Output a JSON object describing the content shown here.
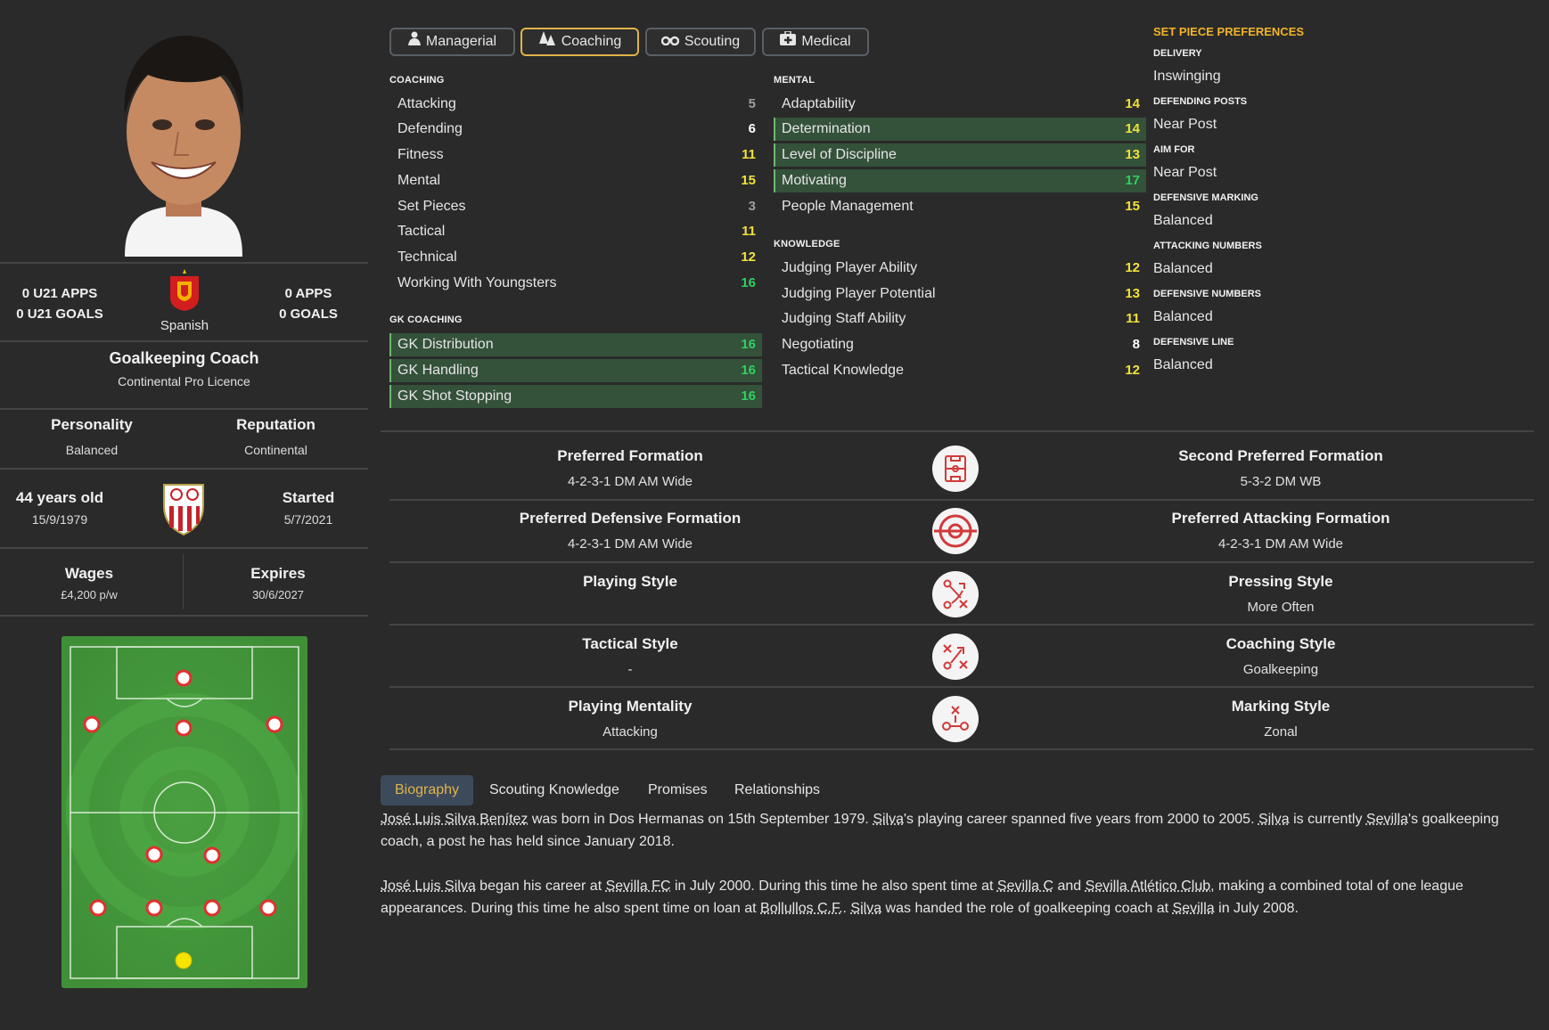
{
  "profile": {
    "u21_apps": "0 U21 APPS",
    "u21_goals": "0 U21 GOALS",
    "apps": "0 APPS",
    "goals": "0 GOALS",
    "nationality": "Spanish",
    "role": "Goalkeeping Coach",
    "licence": "Continental Pro Licence",
    "personality_label": "Personality",
    "personality": "Balanced",
    "reputation_label": "Reputation",
    "reputation": "Continental",
    "age": "44 years old",
    "dob": "15/9/1979",
    "started_label": "Started",
    "started": "5/7/2021",
    "wages_label": "Wages",
    "wages": "£4,200 p/w",
    "expires_label": "Expires",
    "expires": "30/6/2027"
  },
  "tabs": [
    "Managerial",
    "Coaching",
    "Scouting",
    "Medical"
  ],
  "active_tab": "Coaching",
  "coaching": {
    "heading": "COACHING",
    "rows": [
      {
        "label": "Attacking",
        "value": "5"
      },
      {
        "label": "Defending",
        "value": "6"
      },
      {
        "label": "Fitness",
        "value": "11"
      },
      {
        "label": "Mental",
        "value": "15"
      },
      {
        "label": "Set Pieces",
        "value": "3"
      },
      {
        "label": "Tactical",
        "value": "11"
      },
      {
        "label": "Technical",
        "value": "12"
      },
      {
        "label": "Working With Youngsters",
        "value": "16"
      }
    ]
  },
  "gk_coaching": {
    "heading": "GK COACHING",
    "rows": [
      {
        "label": "GK Distribution",
        "value": "16"
      },
      {
        "label": "GK Handling",
        "value": "16"
      },
      {
        "label": "GK Shot Stopping",
        "value": "16"
      }
    ]
  },
  "mental": {
    "heading": "MENTAL",
    "rows": [
      {
        "label": "Adaptability",
        "value": "14"
      },
      {
        "label": "Determination",
        "value": "14"
      },
      {
        "label": "Level of Discipline",
        "value": "13"
      },
      {
        "label": "Motivating",
        "value": "17"
      },
      {
        "label": "People Management",
        "value": "15"
      }
    ]
  },
  "knowledge": {
    "heading": "KNOWLEDGE",
    "rows": [
      {
        "label": "Judging Player Ability",
        "value": "12"
      },
      {
        "label": "Judging Player Potential",
        "value": "13"
      },
      {
        "label": "Judging Staff Ability",
        "value": "11"
      },
      {
        "label": "Negotiating",
        "value": "8"
      },
      {
        "label": "Tactical Knowledge",
        "value": "12"
      }
    ]
  },
  "set_pieces": {
    "title": "SET PIECE PREFERENCES",
    "items": [
      {
        "label": "DELIVERY",
        "value": "Inswinging"
      },
      {
        "label": "DEFENDING POSTS",
        "value": "Near Post"
      },
      {
        "label": "AIM FOR",
        "value": "Near Post"
      },
      {
        "label": "DEFENSIVE MARKING",
        "value": "Balanced"
      },
      {
        "label": "ATTACKING NUMBERS",
        "value": "Balanced"
      },
      {
        "label": "DEFENSIVE NUMBERS",
        "value": "Balanced"
      },
      {
        "label": "DEFENSIVE LINE",
        "value": "Balanced"
      }
    ]
  },
  "tactics": [
    {
      "left_label": "Preferred Formation",
      "left_value": "4-2-3-1 DM AM Wide",
      "icon": "formation-icon",
      "right_label": "Second Preferred Formation",
      "right_value": "5-3-2 DM WB"
    },
    {
      "left_label": "Preferred Defensive Formation",
      "left_value": "4-2-3-1 DM AM Wide",
      "icon": "target-icon",
      "right_label": "Preferred Attacking Formation",
      "right_value": "4-2-3-1 DM AM Wide"
    },
    {
      "left_label": "Playing Style",
      "left_value": "",
      "icon": "playing-style-icon",
      "right_label": "Pressing Style",
      "right_value": "More Often"
    },
    {
      "left_label": "Tactical Style",
      "left_value": "-",
      "icon": "tactics-board-icon",
      "right_label": "Coaching Style",
      "right_value": "Goalkeeping"
    },
    {
      "left_label": "Playing Mentality",
      "left_value": "Attacking",
      "icon": "mentality-icon",
      "right_label": "Marking Style",
      "right_value": "Zonal"
    }
  ],
  "bio_tabs": [
    "Biography",
    "Scouting Knowledge",
    "Promises",
    "Relationships"
  ],
  "bio": {
    "p1": [
      {
        "t": "José Luis Silva Benítez",
        "u": true
      },
      {
        "t": " was born in Dos Hermanas on 15th September 1979. ",
        "u": false
      },
      {
        "t": "Silva",
        "u": true
      },
      {
        "t": "'s playing career spanned five years from 2000 to 2005. ",
        "u": false
      },
      {
        "t": "Silva",
        "u": true
      },
      {
        "t": " is currently ",
        "u": false
      },
      {
        "t": "Sevilla",
        "u": true
      },
      {
        "t": "'s goalkeeping coach, a post he has held since January 2018.",
        "u": false
      }
    ],
    "p2": [
      {
        "t": "José Luis Silva",
        "u": true
      },
      {
        "t": " began his career at ",
        "u": false
      },
      {
        "t": "Sevilla FC",
        "u": true
      },
      {
        "t": " in July 2000. During this time he also spent time at ",
        "u": false
      },
      {
        "t": "Sevilla C",
        "u": true
      },
      {
        "t": " and ",
        "u": false
      },
      {
        "t": "Sevilla Atlético Club",
        "u": true
      },
      {
        "t": ", making a combined total of one league appearances. During this time he also spent time on loan at ",
        "u": false
      },
      {
        "t": "Bollullos C.F.",
        "u": true
      },
      {
        "t": ". ",
        "u": false
      },
      {
        "t": "Silva",
        "u": true
      },
      {
        "t": " was handed the role of goalkeeping coach at ",
        "u": false
      },
      {
        "t": "Sevilla",
        "u": true
      },
      {
        "t": " in July 2008.",
        "u": false
      }
    ]
  },
  "colors": {
    "background": "#2a2a2a",
    "accent": "#e0b34a",
    "set_piece_title": "#f0b429",
    "highlight_row": "#34513a",
    "value_green": "#2ed15f",
    "value_yellow": "#f2e13b",
    "pitch": "#4a9b3f",
    "player_marker": "#e03030"
  }
}
